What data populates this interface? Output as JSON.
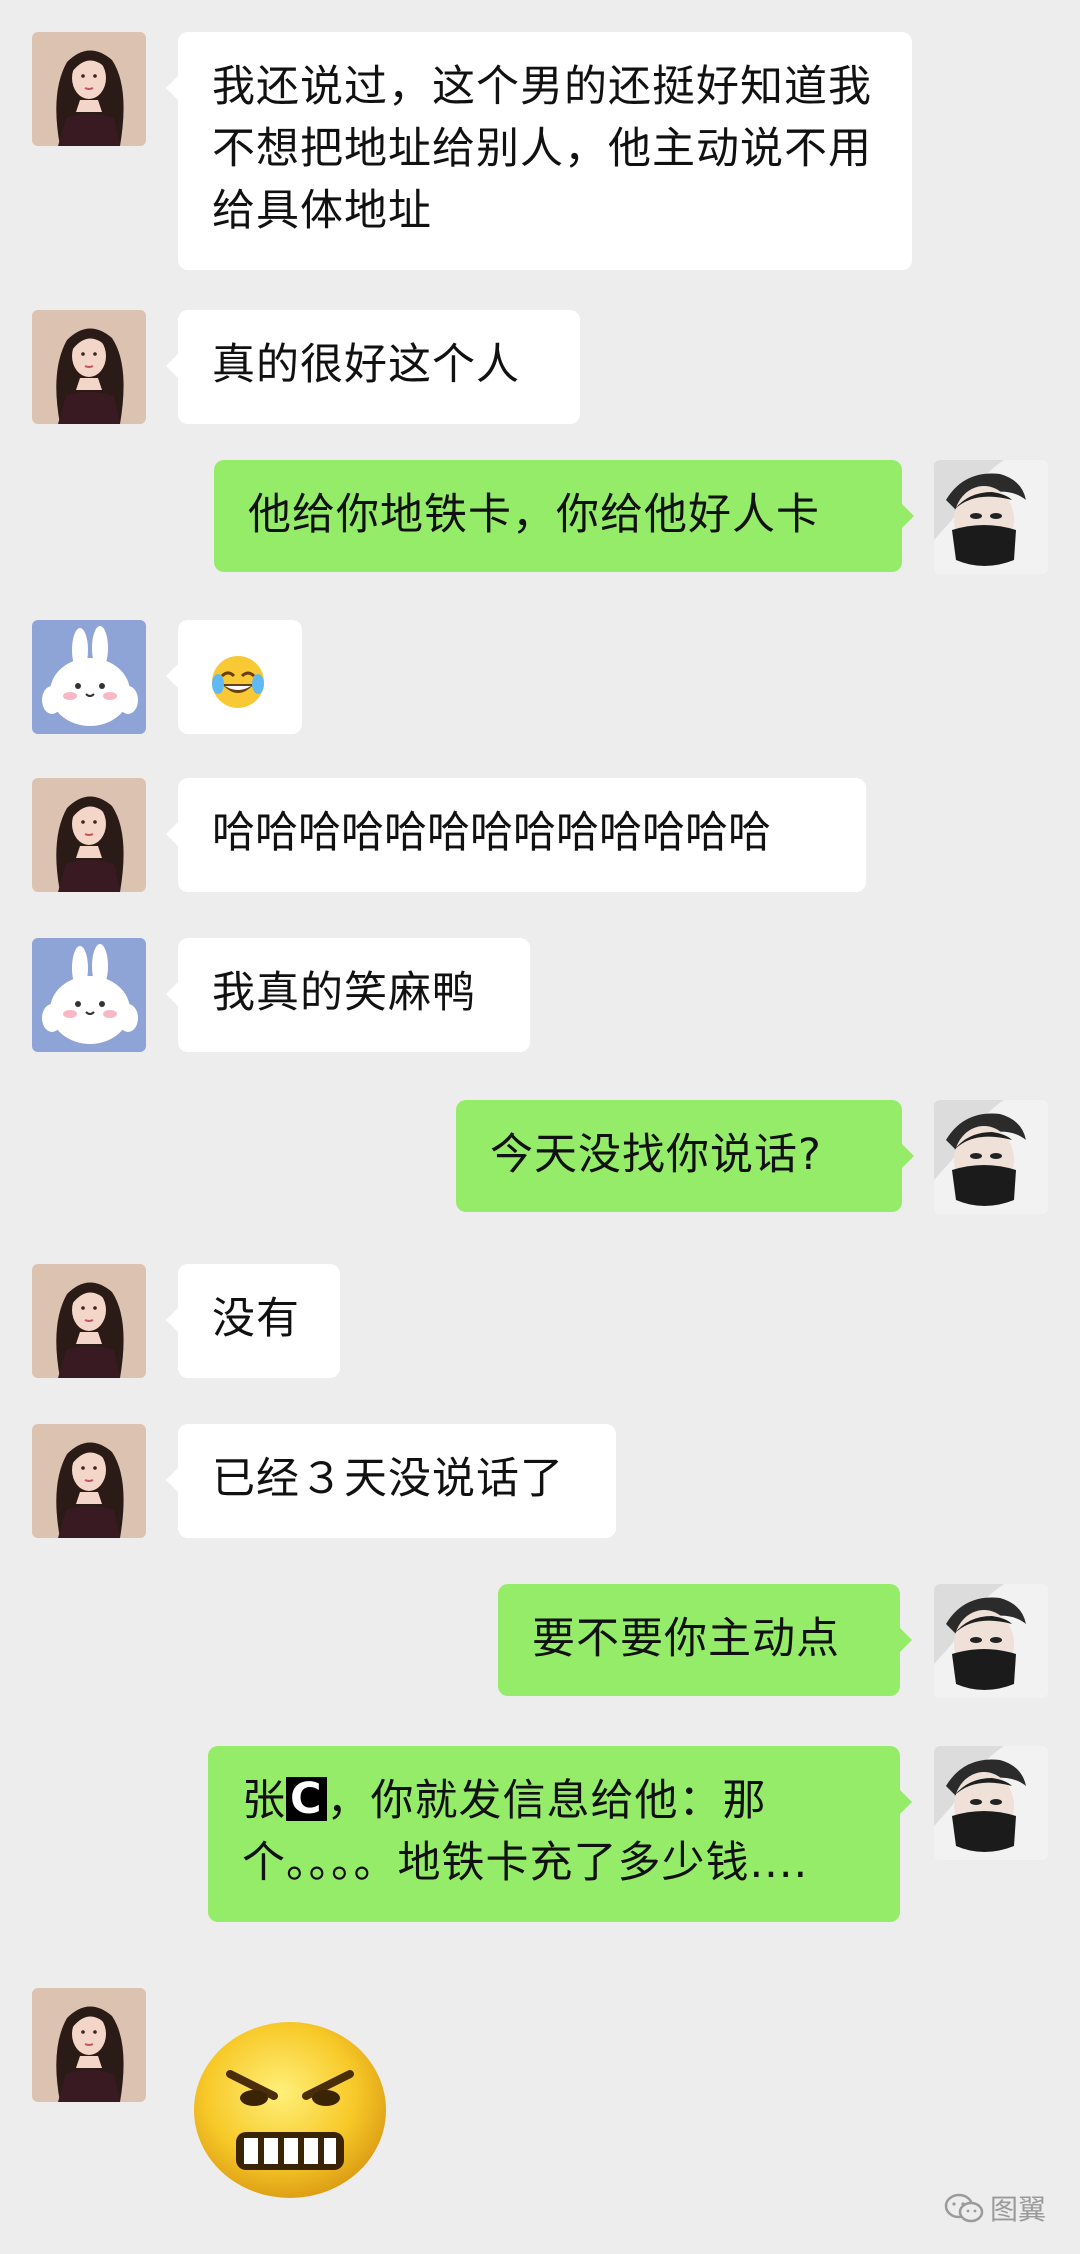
{
  "messages": [
    {
      "side": "left",
      "avatar": "girl-avatar",
      "text": "我还说过，这个男的还挺好知道我不想把地址给别人，他主动说不用给具体地址"
    },
    {
      "side": "left",
      "avatar": "girl-avatar",
      "text": "真的很好这个人"
    },
    {
      "side": "right",
      "avatar": "boy-masked-avatar",
      "text": "他给你地铁卡，你给他好人卡"
    },
    {
      "side": "left",
      "avatar": "rabbit-avatar",
      "emoji": "tears-of-joy-emoji"
    },
    {
      "side": "left",
      "avatar": "girl-avatar",
      "text": "哈哈哈哈哈哈哈哈哈哈哈哈哈"
    },
    {
      "side": "left",
      "avatar": "rabbit-avatar",
      "text": "我真的笑麻鸭"
    },
    {
      "side": "right",
      "avatar": "boy-masked-avatar",
      "text": "今天没找你说话?"
    },
    {
      "side": "left",
      "avatar": "girl-avatar",
      "text": "没有"
    },
    {
      "side": "left",
      "avatar": "girl-avatar",
      "text": "已经３天没说话了"
    },
    {
      "side": "right",
      "avatar": "boy-masked-avatar",
      "text": "要不要你主动点"
    },
    {
      "side": "right",
      "avatar": "boy-masked-avatar",
      "prefix": "张",
      "redacted": "C",
      "text": "，你就发信息给他：那个。。。。地铁卡充了多少钱...."
    },
    {
      "side": "left",
      "avatar": "girl-avatar",
      "sticker": "angry-face-sticker"
    }
  ],
  "watermark": {
    "icon": "wechat-icon",
    "text": "图翼"
  },
  "colors": {
    "background": "#ededed",
    "bubble_left": "#ffffff",
    "bubble_right": "#95ec69"
  }
}
